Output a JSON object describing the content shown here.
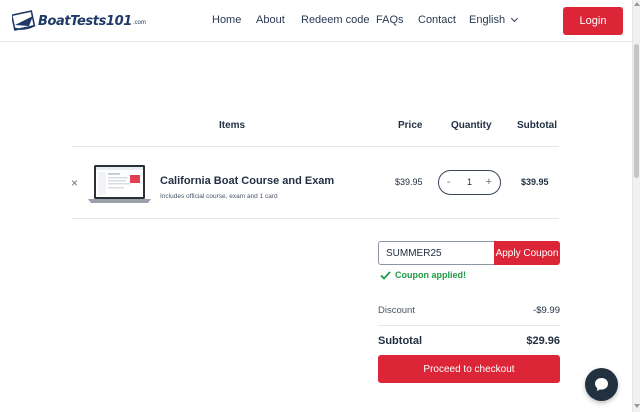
{
  "header": {
    "logo_text": "BoatTests101",
    "logo_suffix": ".com",
    "nav": [
      {
        "label": "Home"
      },
      {
        "label": "About"
      },
      {
        "label": "Redeem code"
      },
      {
        "label": "FAQs"
      },
      {
        "label": "Contact"
      },
      {
        "label": "English"
      }
    ],
    "login_label": "Login"
  },
  "cart": {
    "columns": {
      "items": "Items",
      "price": "Price",
      "quantity": "Quantity",
      "subtotal": "Subtotal"
    },
    "item": {
      "remove_symbol": "×",
      "name": "California Boat Course and Exam",
      "description": "Includes official course, exam and 1 card",
      "price": "$39.95",
      "quantity": "1",
      "minus": "-",
      "plus": "+",
      "subtotal": "$39.95"
    }
  },
  "coupon": {
    "value": "SUMMER25",
    "apply_label": "Apply Coupon",
    "status": "Coupon applied!"
  },
  "totals": {
    "discount_label": "Discount",
    "discount_value": "-$9.99",
    "subtotal_label": "Subtotal",
    "subtotal_value": "$29.96",
    "checkout_label": "Proceed to checkout"
  },
  "colors": {
    "accent": "#dc2637",
    "navy": "#1f3a66",
    "success": "#1e9a46",
    "chat": "#21313f"
  }
}
